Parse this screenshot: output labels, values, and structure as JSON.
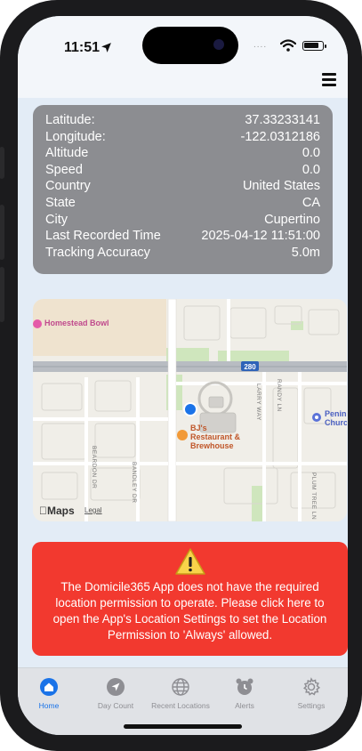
{
  "status": {
    "time": "11:51",
    "signal_dots": "....",
    "battery_level": 0.85
  },
  "header": {
    "menu_icon": "hamburger-menu-icon"
  },
  "location": {
    "rows": [
      {
        "label": "Latitude:",
        "value": "37.33233141"
      },
      {
        "label": "Longitude:",
        "value": "-122.0312186"
      },
      {
        "label": "Altitude",
        "value": "0.0"
      },
      {
        "label": "Speed",
        "value": "0.0"
      },
      {
        "label": "Country",
        "value": "United States"
      },
      {
        "label": "State",
        "value": "CA"
      },
      {
        "label": "City",
        "value": "Cupertino"
      },
      {
        "label": "Last Recorded Time",
        "value": "2025-04-12 11:51:00"
      },
      {
        "label": "Tracking Accuracy",
        "value": "5.0m"
      }
    ]
  },
  "map": {
    "pois": {
      "homestead_bowl": "Homestead Bowl",
      "bjs": "BJ's Restaurant & Brewhouse",
      "church": "Penin Churc"
    },
    "roads": {
      "highway": "280",
      "larry_way": "LARRY WAY",
      "randy_ln": "RANDY LN",
      "beardon_dr": "BEARDON DR",
      "bandley_dr": "BANDLEY DR",
      "plum_tree_ln": "PLUM TREE LN"
    },
    "brand": "Maps",
    "legal": "Legal"
  },
  "alert": {
    "message": "The Domicile365 App does not have the required location permission to operate.  Please click here to open the App's Location Settings to set the Location Permission to 'Always' allowed.",
    "icon": "warning-icon",
    "color": "#f2392f"
  },
  "tabs": [
    {
      "label": "Home",
      "icon": "home-icon",
      "active": true
    },
    {
      "label": "Day Count",
      "icon": "navigation-arrow-icon",
      "active": false
    },
    {
      "label": "Recent Locations",
      "icon": "globe-icon",
      "active": false
    },
    {
      "label": "Alerts",
      "icon": "alarm-clock-icon",
      "active": false
    },
    {
      "label": "Settings",
      "icon": "gear-icon",
      "active": false
    }
  ],
  "colors": {
    "accent": "#1a73e8",
    "card": "#8c8d91"
  }
}
